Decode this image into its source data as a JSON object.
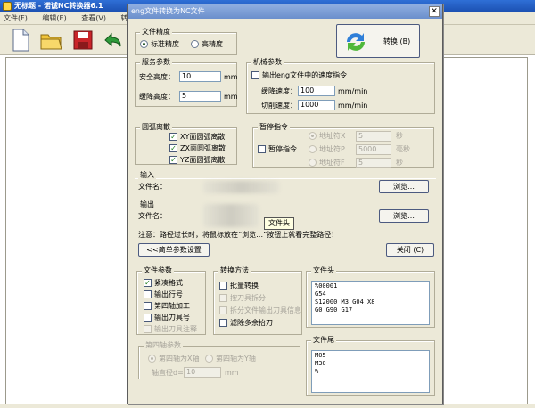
{
  "app": {
    "title": "无标题 - 诺诚NC转换器6.1",
    "menu": [
      "文件(F)",
      "编辑(E)",
      "查看(V)",
      "转换(C)"
    ]
  },
  "toolbar": {
    "icons": [
      "new-file-icon",
      "open-folder-icon",
      "save-disk-icon",
      "undo-arrow-icon"
    ]
  },
  "dialog": {
    "title": "eng文件转换为NC文件",
    "close_glyph": "✕",
    "precision": {
      "title": "文件精度",
      "standard": "标准精度",
      "high": "高精度"
    },
    "convert_button": "转换 (B)",
    "service": {
      "title": "服务参数",
      "safe_height_label": "安全高度：",
      "safe_height_value": "10",
      "slow_height_label": "缓降高度：",
      "slow_height_value": "5",
      "unit": "mm"
    },
    "machine": {
      "title": "机械参数",
      "output_speed": "输出eng文件中的速度指令",
      "slow_speed_label": "缓降速度：",
      "slow_speed_value": "100",
      "cut_speed_label": "切削速度：",
      "cut_speed_value": "1000",
      "unit": "mm/min"
    },
    "arc": {
      "title": "圆弧离散",
      "xy": "XY面圆弧离散",
      "zx": "ZX面圆弧离散",
      "yz": "YZ面圆弧离散"
    },
    "pause": {
      "title": "暂停指令",
      "cmd": "暂停指令",
      "addr_x": "地址符X",
      "addr_x_value": "5",
      "addr_x_unit": "秒",
      "addr_p": "地址符P",
      "addr_p_value": "5000",
      "addr_p_unit": "毫秒",
      "addr_f": "地址符F",
      "addr_f_value": "5",
      "addr_f_unit": "秒"
    },
    "input": {
      "title": "输入",
      "filename_label": "文件名：",
      "browse": "浏览…"
    },
    "output": {
      "title": "输出",
      "filename_label": "文件名：",
      "browse": "浏览…"
    },
    "file_header_tip": "文件头",
    "note": "注意：路径过长时，将鼠标放在“浏览…”按钮上就看完整路径！",
    "simple_button": "<<简单参数设置",
    "close_button": "关闭 (C)",
    "file_params": {
      "title": "文件参数",
      "compact": "紧凑格式",
      "line_no": "输出行号",
      "fourth_axis": "第四轴加工",
      "tool_no": "输出刀具号",
      "tool_note": "输出刀具注释"
    },
    "convert_method": {
      "title": "转换方法",
      "batch": "批量转换",
      "split_tool": "按刀具拆分",
      "split_file": "拆分文件输出刀具信息",
      "filter_lift": "滤除多余抬刀"
    },
    "file_head": {
      "title": "文件头",
      "lines": [
        "%00001",
        "G54",
        "S12000 M3 G04 X8",
        "G0 G90 G17"
      ]
    },
    "file_tail": {
      "title": "文件尾",
      "lines": [
        "M05",
        "M30",
        "%"
      ]
    },
    "fourth_axis_params": {
      "title": "第四轴参数",
      "x_axis": "第四轴为X轴",
      "y_axis": "第四轴为Y轴",
      "dia_label": "轴直径d=",
      "dia_value": "10",
      "unit": "mm"
    }
  }
}
